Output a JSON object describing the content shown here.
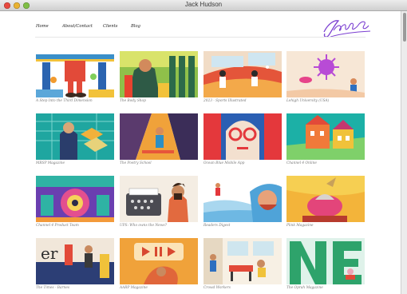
{
  "window": {
    "title": "Jack Hudson"
  },
  "nav": {
    "items": [
      "Home",
      "About/Contact",
      "Clients",
      "Blog"
    ]
  },
  "logo": {
    "text": "Jack Hudson",
    "color": "#7b3fd1"
  },
  "projects": [
    "A Step Into the Third Dimension",
    "The Body Shop",
    "2023 - Sports Illustrated",
    "Lehigh University (USA)",
    "MRSP Magazine",
    "The Poetry School",
    "Ocean Blue Mobile App",
    "Channel 4 Online",
    "Channel 4 Product Team",
    "UPS: Who owns the News?",
    "Readers Digest",
    "Plink Magazine",
    "The Times - Barnes",
    "AARP Magazine",
    "Crowd Workers",
    "The Oprah Magazine"
  ]
}
